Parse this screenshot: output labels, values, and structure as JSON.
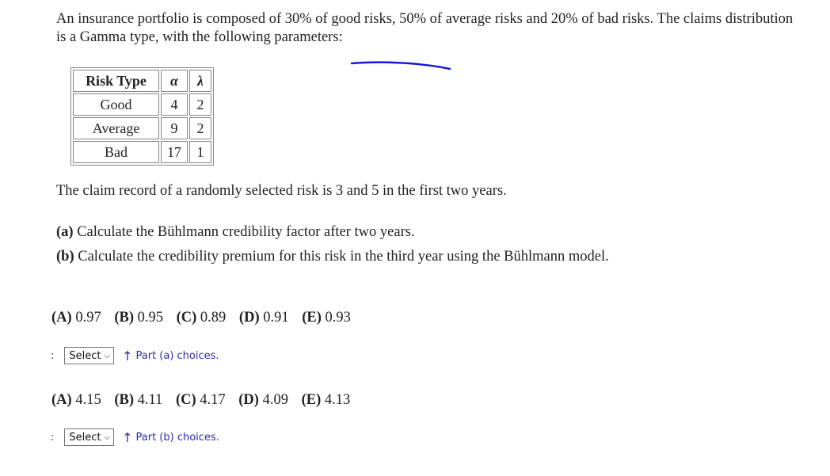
{
  "intro": "An insurance portfolio is composed of 30% of good risks, 50% of average risks and 20% of bad risks. The claims distribution is a Gamma type, with the following parameters:",
  "table": {
    "headers": [
      "Risk Type",
      "α",
      "λ"
    ],
    "rows": [
      [
        "Good",
        "4",
        "2"
      ],
      [
        "Average",
        "9",
        "2"
      ],
      [
        "Bad",
        "17",
        "1"
      ]
    ]
  },
  "claim_record": "The claim record of a randomly selected risk is 3 and 5 in the first two years.",
  "questions": [
    {
      "label": "(a)",
      "text": " Calculate the Bühlmann credibility factor after two years."
    },
    {
      "label": "(b)",
      "text": " Calculate the credibility premium for this risk in the third year using the Bühlmann model."
    }
  ],
  "part_a": {
    "choices": [
      {
        "label": "(A)",
        "value": "0.97"
      },
      {
        "label": "(B)",
        "value": "0.95"
      },
      {
        "label": "(C)",
        "value": "0.89"
      },
      {
        "label": "(D)",
        "value": "0.91"
      },
      {
        "label": "(E)",
        "value": "0.93"
      }
    ],
    "colon": ":",
    "select_value": "Select",
    "arrow": "↑",
    "hint": "Part (a) choices."
  },
  "part_b": {
    "choices": [
      {
        "label": "(A)",
        "value": "4.15"
      },
      {
        "label": "(B)",
        "value": "4.11"
      },
      {
        "label": "(C)",
        "value": "4.17"
      },
      {
        "label": "(D)",
        "value": "4.09"
      },
      {
        "label": "(E)",
        "value": "4.13"
      }
    ],
    "colon": ":",
    "select_value": "Select",
    "arrow": "↑",
    "hint": "Part (b) choices."
  },
  "colors": {
    "annotation_stroke": "#1a1adb",
    "hint_text": "#2a2ab0"
  }
}
